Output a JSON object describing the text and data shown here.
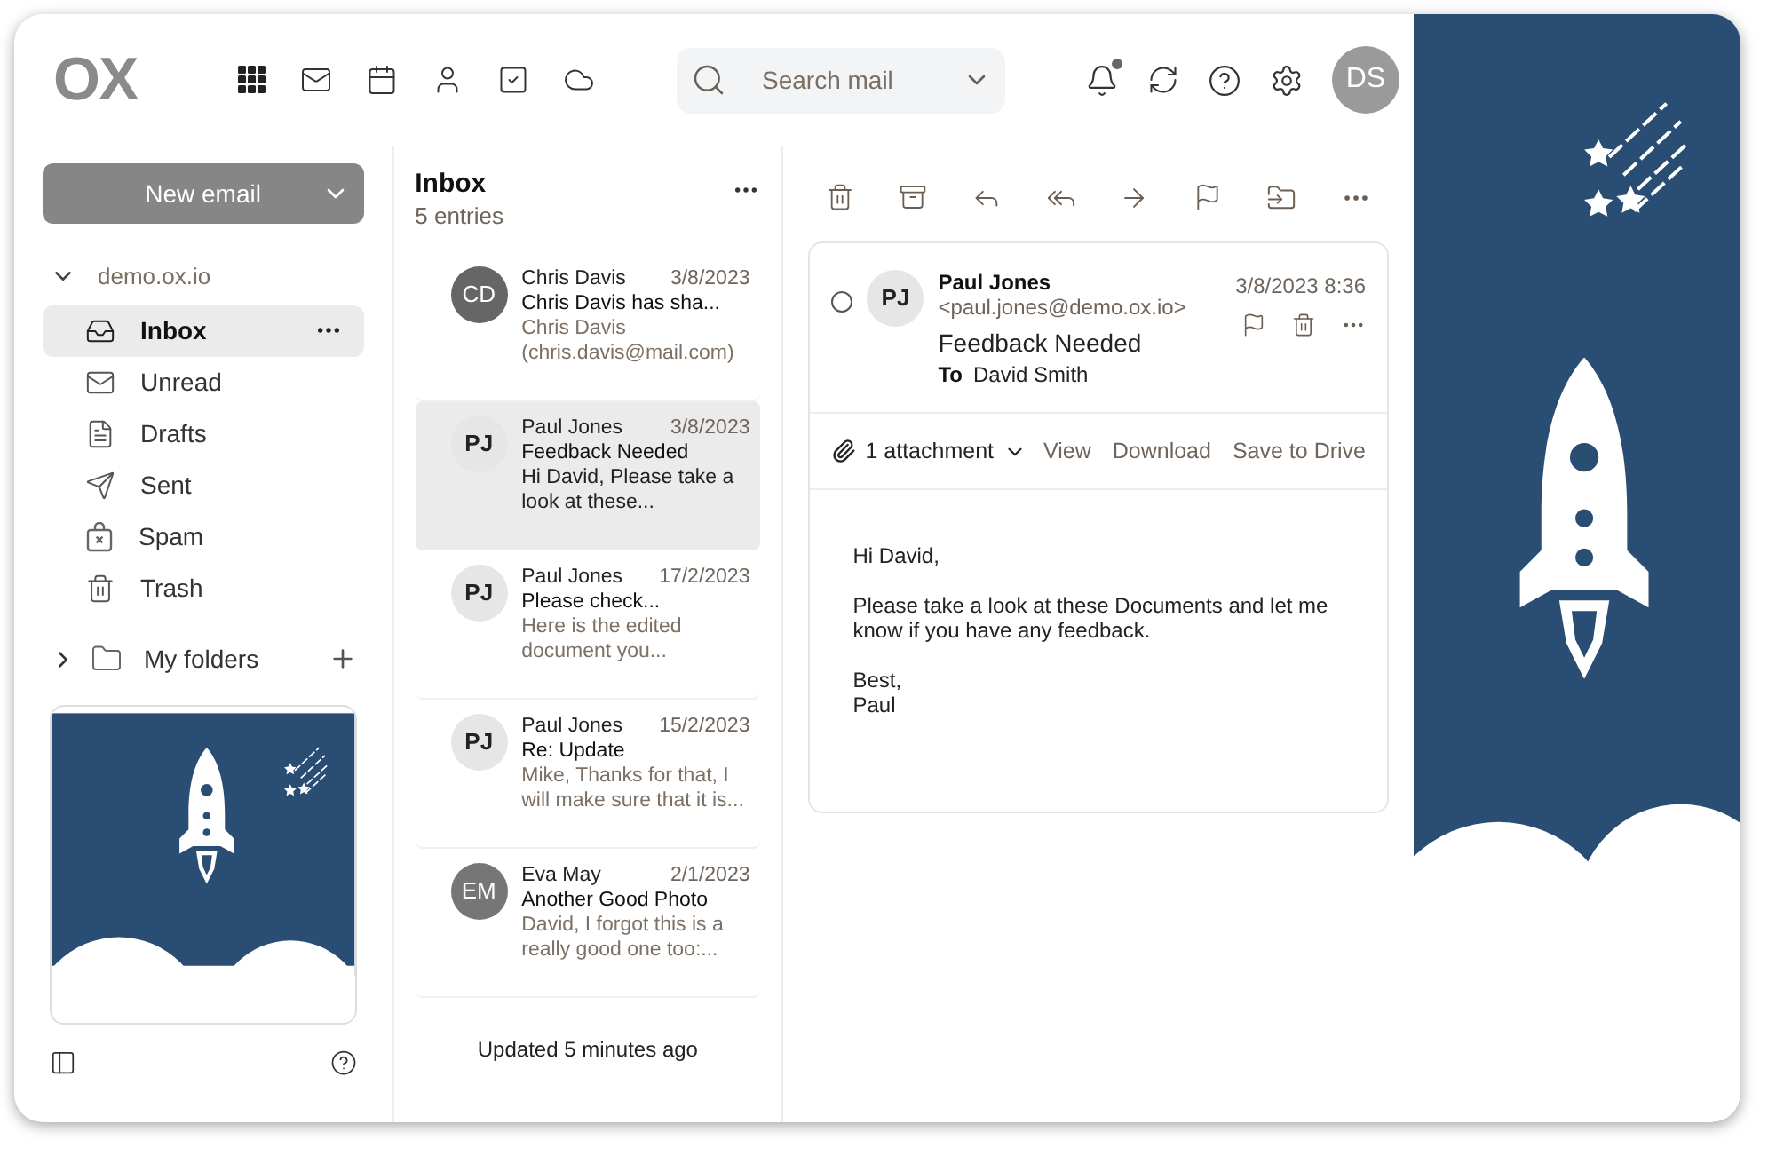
{
  "header": {
    "logo": "OX",
    "search": {
      "placeholder": "Search mail"
    },
    "notifications": {
      "unread": true
    },
    "avatar": {
      "initials": "DS"
    }
  },
  "sidebar": {
    "new_email": "New email",
    "account": {
      "label": "demo.ox.io",
      "expanded": true
    },
    "folders": [
      {
        "kind": "inbox",
        "label": "Inbox",
        "selected": true
      },
      {
        "kind": "unread",
        "label": "Unread",
        "selected": false
      },
      {
        "kind": "drafts",
        "label": "Drafts",
        "selected": false
      },
      {
        "kind": "sent",
        "label": "Sent",
        "selected": false
      },
      {
        "kind": "spam",
        "label": "Spam",
        "selected": false
      },
      {
        "kind": "trash",
        "label": "Trash",
        "selected": false
      }
    ],
    "my_folders": {
      "label": "My folders",
      "expanded": false
    }
  },
  "list": {
    "title": "Inbox",
    "count": "5 entries",
    "messages": [
      {
        "initials": "CD",
        "color": "#666666",
        "sender": "Chris Davis",
        "date": "3/8/2023",
        "subject": "Chris Davis has sha...",
        "preview": "Chris Davis (chris.davis@mail.com)",
        "selected": false
      },
      {
        "initials": "PJ",
        "color": "#e6e6e6",
        "sender": "Paul Jones",
        "date": "3/8/2023",
        "subject": "Feedback Needed",
        "preview": "Hi David, Please take a look at these...",
        "selected": true
      },
      {
        "initials": "PJ",
        "color": "#e6e6e6",
        "sender": "Paul Jones",
        "date": "17/2/2023",
        "subject": "Please check...",
        "preview": "Here is the edited document you...",
        "selected": false
      },
      {
        "initials": "PJ",
        "color": "#e6e6e6",
        "sender": "Paul Jones",
        "date": "15/2/2023",
        "subject": "Re: Update",
        "preview": "Mike, Thanks for that, I will make sure that it is...",
        "selected": false
      },
      {
        "initials": "EM",
        "color": "#767676",
        "sender": "Eva May",
        "date": "2/1/2023",
        "subject": "Another Good Photo",
        "preview": "David, I forgot this is a really good one too:...",
        "selected": false
      }
    ],
    "footer": "Updated 5 minutes ago"
  },
  "message": {
    "selected": false,
    "initials": "PJ",
    "sender": "Paul Jones",
    "email": "<paul.jones@demo.ox.io>",
    "date": "3/8/2023 8:36",
    "subject": "Feedback Needed",
    "to_label": "To",
    "to": "David Smith",
    "attachment": "1 attachment",
    "attachment_actions": [
      "View",
      "Download",
      "Save to Drive"
    ],
    "body": [
      "Hi David,",
      "Please take a look at these Documents and let me know if you have any feedback.",
      "Best,\nPaul"
    ]
  }
}
